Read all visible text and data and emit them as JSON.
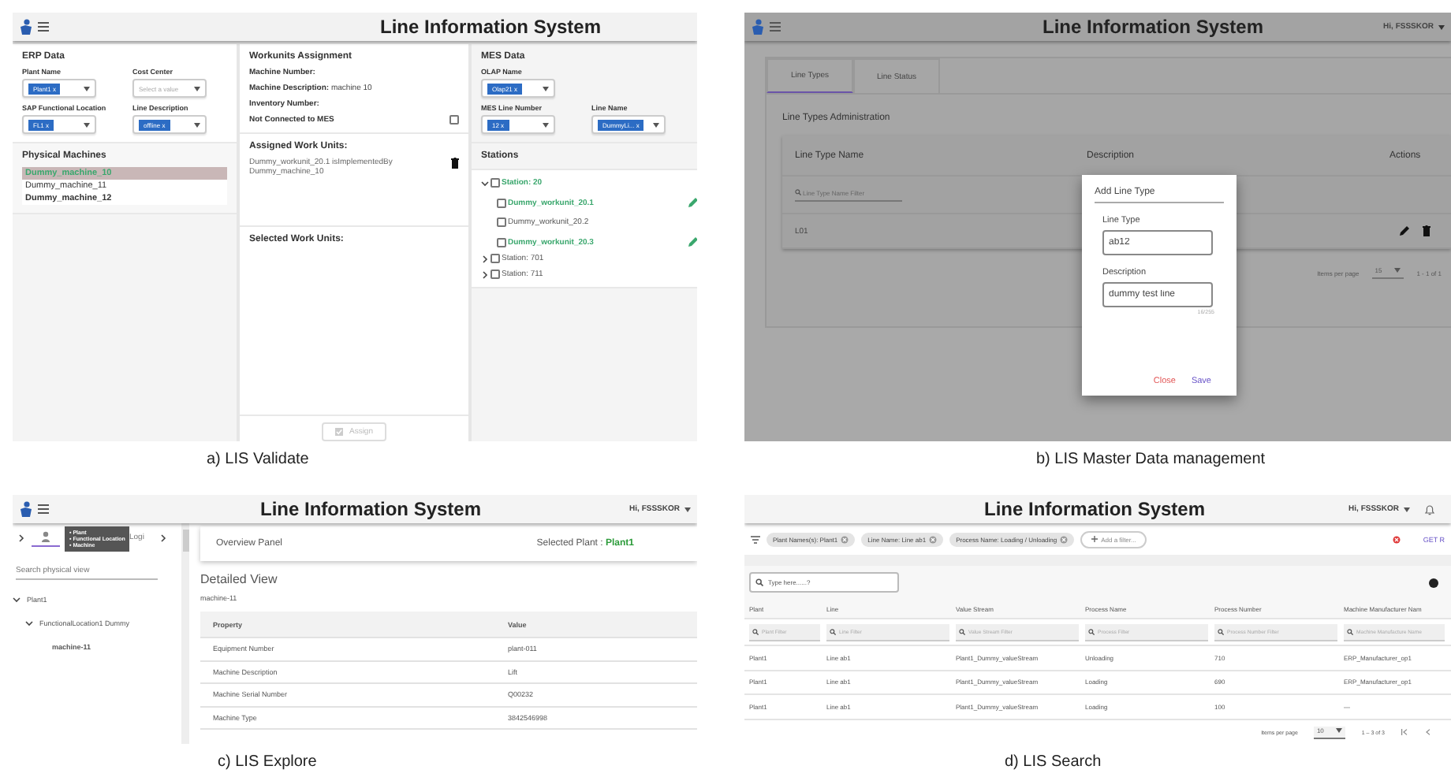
{
  "validate": {
    "app_title": "Line Information System",
    "caption": "a) LIS Validate",
    "erp": {
      "title": "ERP Data",
      "rows": [
        [
          {
            "label": "Plant Name",
            "value": "Plant1 x"
          },
          {
            "label": "Cost Center",
            "placeholder": "Select a value"
          }
        ],
        [
          {
            "label": "SAP Functional Location",
            "value": "FL1 x"
          },
          {
            "label": "Line Description",
            "value": "offline x"
          }
        ]
      ]
    },
    "machines": {
      "title": "Physical Machines",
      "items": [
        {
          "label": "Dummy_machine_10",
          "selected": true,
          "bold": true
        },
        {
          "label": "Dummy_machine_11",
          "selected": false,
          "bold": false
        },
        {
          "label": "Dummy_machine_12",
          "selected": false,
          "bold": true
        }
      ]
    },
    "assignment": {
      "title": "Workunits Assignment",
      "fields": [
        {
          "label": "Machine Number:"
        },
        {
          "label": "Machine Description:",
          "value": "machine 10"
        },
        {
          "label": "Inventory Number:"
        }
      ],
      "mes_option": {
        "label": "Not Connected to MES",
        "checked": false
      }
    },
    "assigned": {
      "title": "Assigned Work Units:",
      "items": [
        "Dummy_workunit_20.1 isImplementedBy Dummy_machine_10"
      ]
    },
    "selected_units": {
      "title": "Selected Work Units:"
    },
    "assign_button": {
      "label": "Assign",
      "disabled": true
    },
    "mes": {
      "title": "MES Data",
      "rows": [
        [
          {
            "label": "OLAP Name",
            "value": "Olap21 x"
          }
        ],
        [
          {
            "label": "MES Line Number",
            "value": "12 x"
          },
          {
            "label": "Line Name",
            "value": "DummyLi... x"
          }
        ]
      ]
    },
    "stations": {
      "title": "Stations",
      "items": [
        {
          "label": "Station: 20",
          "expanded": true,
          "checked": false,
          "highlighted": true,
          "children": [
            {
              "label": "Dummy_workunit_20.1",
              "checked": false,
              "highlighted": true
            },
            {
              "label": "Dummy_workunit_20.2",
              "checked": false,
              "highlighted": false
            },
            {
              "label": "Dummy_workunit_20.3",
              "checked": false,
              "highlighted": true
            }
          ]
        },
        {
          "label": "Station: 701",
          "expanded": false,
          "checked": false,
          "highlighted": false
        },
        {
          "label": "Station: 711",
          "expanded": false,
          "checked": false,
          "highlighted": false
        }
      ]
    }
  },
  "master_data": {
    "app_title": "Line Information System",
    "user": "Hi, FSSSKOR",
    "caption": "b) LIS Master Data management",
    "tabs": [
      {
        "label": "Line Types",
        "selected": true
      },
      {
        "label": "Line Status",
        "selected": false
      }
    ],
    "section_title": "Line Types Administration",
    "columns": [
      "Line Type Name",
      "Description",
      "Actions"
    ],
    "filter_placeholder": "Line Type Name Filter",
    "rows": [
      {
        "name": "L01"
      }
    ],
    "paginator": {
      "label": "Items per page",
      "page_size": "15",
      "range": "1 - 1 of 1"
    },
    "dialog": {
      "title": "Add Line Type",
      "fields": [
        {
          "label": "Line Type",
          "value": "ab12"
        },
        {
          "label": "Description",
          "value": "dummy test line",
          "counter": "16/255"
        }
      ],
      "actions": [
        {
          "label": "Close",
          "kind": "cancel"
        },
        {
          "label": "Save",
          "kind": "confirm"
        }
      ]
    }
  },
  "explore": {
    "app_title": "Line Information System",
    "user": "Hi, FSSSKOR",
    "caption": "c) LIS Explore",
    "tabs": [
      {
        "kind": "physical",
        "selected": true
      },
      {
        "kind": "logical",
        "label": "Logi",
        "selected": false
      }
    ],
    "tooltip": [
      "• Plant",
      "• Functional Location",
      "• Machine"
    ],
    "search_placeholder": "Search physical view",
    "tree": [
      {
        "label": "Plant1",
        "expanded": true,
        "selected": false,
        "children": [
          {
            "label": "FunctionalLocation1 Dummy",
            "expanded": true,
            "selected": false,
            "children": [
              {
                "label": "machine-11",
                "selected": true
              }
            ]
          }
        ]
      }
    ],
    "overview": {
      "title": "Overview Panel",
      "plant_label": "Selected Plant :",
      "plant": "Plant1"
    },
    "detail": {
      "title": "Detailed View",
      "machine": "machine-11",
      "columns": [
        "Property",
        "Value"
      ],
      "rows": [
        [
          "Equipment Number",
          "plant-011"
        ],
        [
          "Machine Description",
          "Lift"
        ],
        [
          "Machine Serial Number",
          "Q00232"
        ],
        [
          "Machine Type",
          "3842546998"
        ]
      ]
    }
  },
  "search": {
    "app_title": "Line Information System",
    "user": "Hi, FSSSKOR",
    "caption": "d) LIS Search",
    "filters": [
      "Plant Names(s): Plant1",
      "Line Name: Line ab1",
      "Process Name: Loading / Unloading"
    ],
    "add_filter": "Add a filter...",
    "get_results": "GET R",
    "search_placeholder": "Type here......?",
    "columns": [
      {
        "label": "Plant",
        "filter": "Plant Filter"
      },
      {
        "label": "Line",
        "filter": "Line Filter"
      },
      {
        "label": "Value Stream",
        "filter": "Value Stream Filter"
      },
      {
        "label": "Process Name",
        "filter": "Process Filter"
      },
      {
        "label": "Process Number",
        "filter": "Process Number Filter"
      },
      {
        "label": "Machine Manufacturer Nam",
        "filter": "Machine Manufacture Name"
      }
    ],
    "rows": [
      [
        "Plant1",
        "Line ab1",
        "Plant1_Dummy_valueStream",
        "Unloading",
        "710",
        "ERP_Manufacturer_op1"
      ],
      [
        "Plant1",
        "Line ab1",
        "Plant1_Dummy_valueStream",
        "Loading",
        "690",
        "ERP_Manufacturer_op1"
      ],
      [
        "Plant1",
        "Line ab1",
        "Plant1_Dummy_valueStream",
        "Loading",
        "100",
        "—"
      ]
    ],
    "paginator": {
      "label": "Items per page",
      "page_size": "10",
      "range": "1 – 3 of 3"
    }
  }
}
